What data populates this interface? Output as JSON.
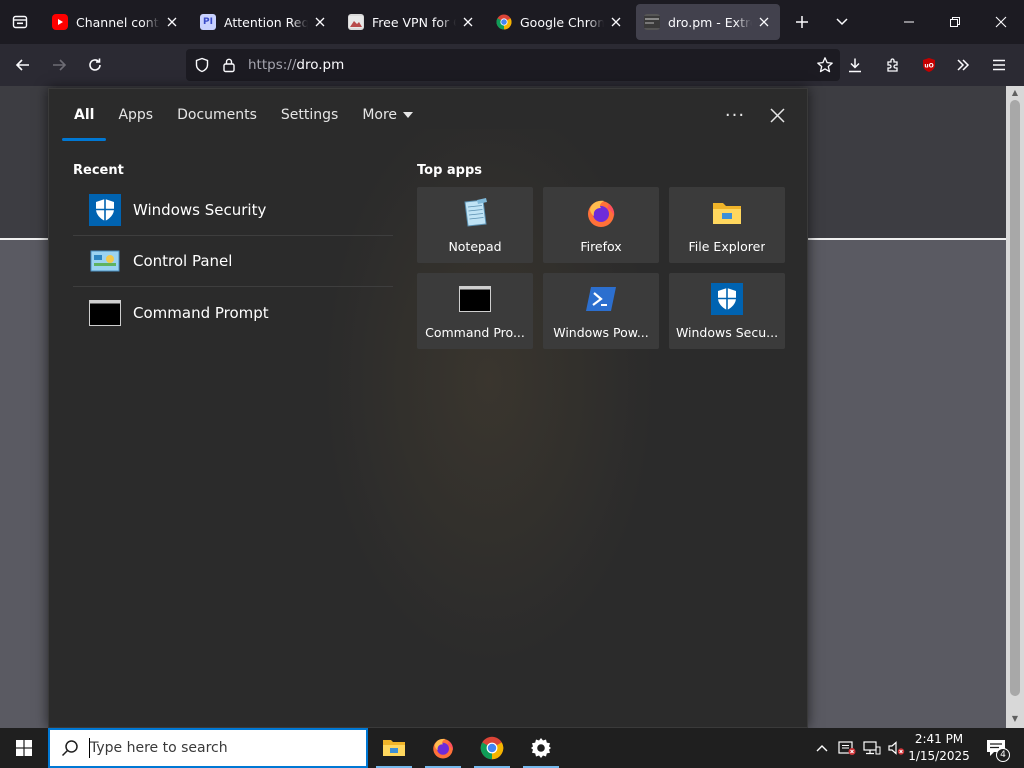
{
  "browser": {
    "tabs": [
      {
        "title": "Channel content",
        "favicon": "youtube-icon",
        "active": false
      },
      {
        "title": "Attention Required!",
        "favicon": "pi-icon",
        "active": false
      },
      {
        "title": "Free VPN for Chrome",
        "favicon": "vpn-icon",
        "active": false
      },
      {
        "title": "Google Chrome",
        "favicon": "chrome-icon",
        "active": false
      },
      {
        "title": "dro.pm - Extremely",
        "favicon": "dropm-icon",
        "active": true
      }
    ],
    "url_protocol": "https://",
    "url_host": "dro.pm",
    "colors": {
      "tabbar": "#1c1b22",
      "navbar": "#2b2a33",
      "active_tab": "#42414d"
    }
  },
  "search_flyout": {
    "tabs": [
      {
        "label": "All",
        "active": true
      },
      {
        "label": "Apps",
        "active": false
      },
      {
        "label": "Documents",
        "active": false
      },
      {
        "label": "Settings",
        "active": false
      },
      {
        "label": "More",
        "active": false
      }
    ],
    "recent_title": "Recent",
    "recent": [
      {
        "label": "Windows Security",
        "icon": "windows-security-icon"
      },
      {
        "label": "Control Panel",
        "icon": "control-panel-icon"
      },
      {
        "label": "Command Prompt",
        "icon": "command-prompt-icon"
      }
    ],
    "top_apps_title": "Top apps",
    "top_apps": [
      {
        "label": "Notepad",
        "icon": "notepad-icon"
      },
      {
        "label": "Firefox",
        "icon": "firefox-icon"
      },
      {
        "label": "File Explorer",
        "icon": "file-explorer-icon"
      },
      {
        "label": "Command Pro...",
        "icon": "command-prompt-icon"
      },
      {
        "label": "Windows Pow...",
        "icon": "powershell-icon"
      },
      {
        "label": "Windows Secu...",
        "icon": "windows-security-icon"
      }
    ],
    "accent": "#0078d4"
  },
  "taskbar": {
    "search_placeholder": "Type here to search",
    "pinned": [
      "file-explorer-icon",
      "firefox-icon",
      "chrome-icon",
      "settings-icon"
    ],
    "time": "2:41 PM",
    "date": "1/15/2025",
    "notification_count": "4"
  }
}
